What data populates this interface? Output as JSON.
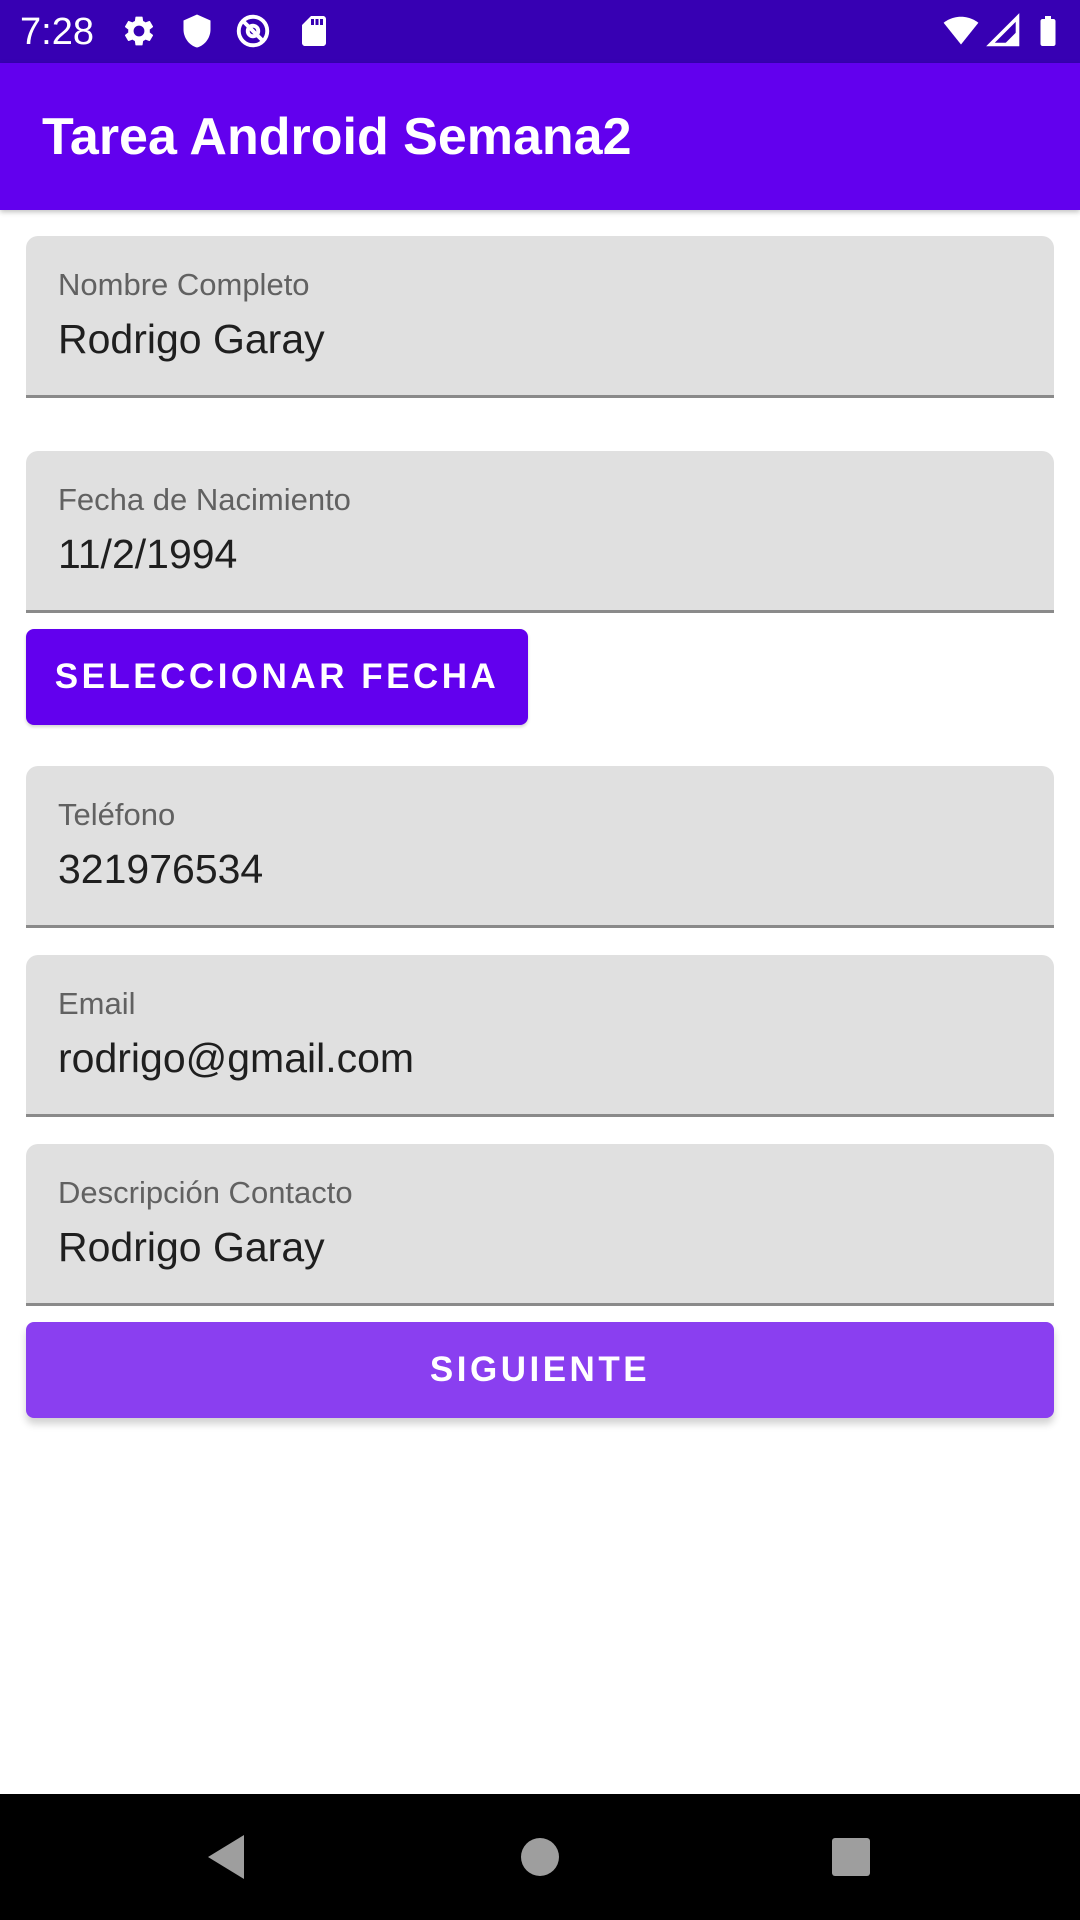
{
  "status_bar": {
    "time": "7:28",
    "left_icons": [
      "settings-icon",
      "shield-icon",
      "at-sign-icon",
      "sd-card-icon"
    ],
    "right_icons": [
      "wifi-icon",
      "signal-icon",
      "battery-icon"
    ]
  },
  "app_bar": {
    "title": "Tarea Android Semana2"
  },
  "form": {
    "nombre": {
      "label": "Nombre Completo",
      "value": "Rodrigo Garay"
    },
    "fecha": {
      "label": "Fecha de Nacimiento",
      "value": "11/2/1994"
    },
    "select_date_label": "SELECCIONAR FECHA",
    "telefono": {
      "label": "Teléfono",
      "value": "321976534"
    },
    "email": {
      "label": "Email",
      "value": "rodrigo@gmail.com"
    },
    "descripcion": {
      "label": "Descripción Contacto",
      "value": "Rodrigo Garay"
    },
    "next_label": "SIGUIENTE"
  },
  "nav_bar": {
    "icons": [
      "back-icon",
      "home-icon",
      "recents-icon"
    ]
  },
  "colors": {
    "status_bar": "#3700b3",
    "primary": "#6200ee",
    "next_button": "#8a3ff0",
    "field_background": "#e0e0e0"
  }
}
